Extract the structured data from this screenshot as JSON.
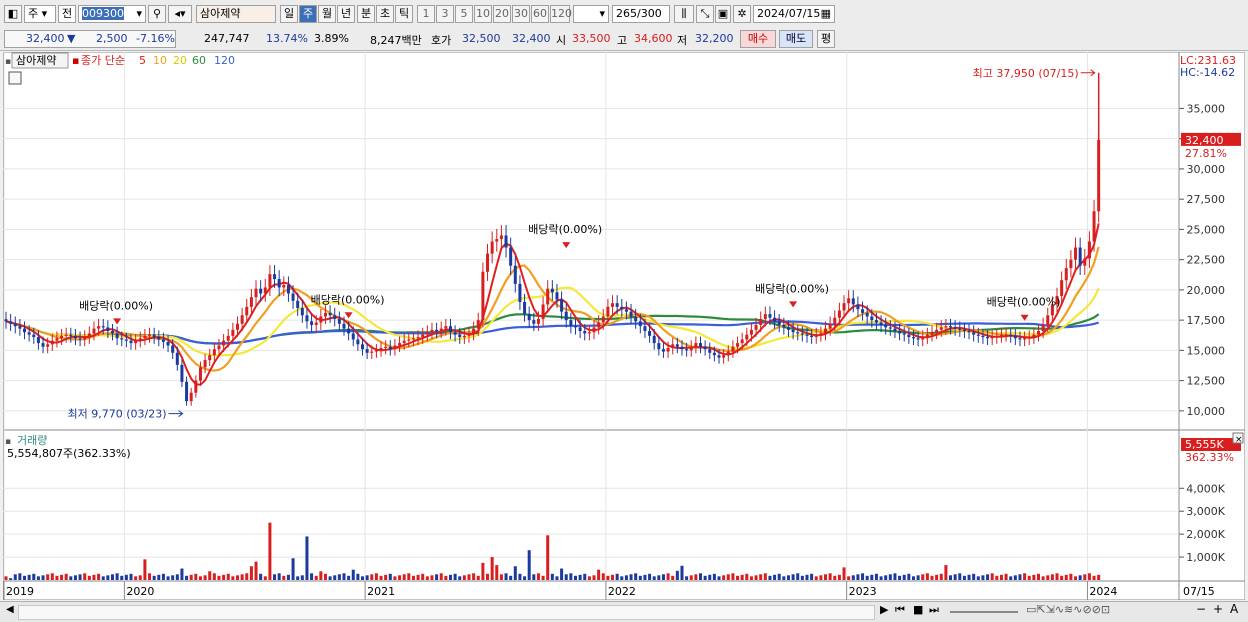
{
  "toolbar": {
    "market": "주",
    "type": "전",
    "code": "009300",
    "name": "삼아제약",
    "periods": [
      "일",
      "주",
      "월",
      "년",
      "분",
      "초",
      "틱"
    ],
    "selected_period": "주",
    "mins": [
      "1",
      "3",
      "5",
      "10",
      "20",
      "30",
      "60",
      "120"
    ],
    "count": "265",
    "count_total": "/300",
    "date": "2024/07/15"
  },
  "info": {
    "price": "32,400",
    "arrow": "▼",
    "change": "2,500",
    "change_pct": "-7.16%",
    "volume": "247,747",
    "vol_ratio": "13.74%",
    "turnover": "3.89%",
    "amount": "8,247백만",
    "ask_label": "호가",
    "ask": "32,500",
    "bid": "32,400",
    "open_label": "시",
    "open": "33,500",
    "high_label": "고",
    "high": "34,600",
    "low_label": "저",
    "low": "32,200",
    "buy": "매수",
    "sell": "매도",
    "avg": "평"
  },
  "chart_data": [
    {
      "type": "candlestick",
      "title": "삼아제약",
      "legend": [
        "종가 단순",
        "5",
        "10",
        "20",
        "60",
        "120"
      ],
      "colors": {
        "up": "#d81e1e",
        "down": "#1b3a9e",
        "ma5": "#e02020",
        "ma10": "#f0a020",
        "ma20": "#f5e83a",
        "ma60": "#2e8b3e",
        "ma120": "#3a5fd8"
      },
      "ylim": [
        8500,
        39500
      ],
      "yticks": [
        "10,000",
        "12,500",
        "15,000",
        "17,500",
        "20,000",
        "22,500",
        "25,000",
        "27,500",
        "30,000",
        "32,500",
        "35,000"
      ],
      "xticks": [
        "2019",
        "2020",
        "2021",
        "2022",
        "2023",
        "2024"
      ],
      "x_end_label": "07/15",
      "last_price_label": "32,400",
      "last_pct_label": "27.81%",
      "lc_label": "LC:231.63",
      "hc_label": "HC:-14.62",
      "high_annotation": "최고 37,950 (07/15)",
      "low_annotation": "최저 9,770 (03/23)",
      "dividend_label": "배당락(0.00%)",
      "weekly_close": [
        17400,
        17200,
        17000,
        16800,
        16500,
        16300,
        16100,
        15600,
        15300,
        15500,
        15800,
        16000,
        16200,
        16300,
        16200,
        16000,
        15900,
        16100,
        16400,
        16800,
        17000,
        16900,
        16600,
        16400,
        16000,
        15900,
        15800,
        15600,
        15800,
        16000,
        16200,
        16300,
        16100,
        15900,
        15700,
        15400,
        14800,
        13800,
        12400,
        10800,
        11500,
        12500,
        13600,
        14200,
        14600,
        15100,
        15400,
        15800,
        16200,
        16700,
        17200,
        17900,
        18600,
        19400,
        20100,
        19700,
        20200,
        21300,
        20900,
        20200,
        20400,
        19700,
        19100,
        18500,
        17900,
        17400,
        17100,
        17300,
        17800,
        18100,
        17900,
        17600,
        17200,
        16800,
        16400,
        15900,
        15500,
        15100,
        14800,
        14900,
        15000,
        15200,
        15300,
        15100,
        15400,
        15600,
        15800,
        15900,
        16000,
        16100,
        16300,
        16500,
        16700,
        16600,
        16800,
        17000,
        16500,
        16300,
        16100,
        16200,
        16400,
        16800,
        17500,
        21500,
        23000,
        24000,
        24200,
        24500,
        23500,
        22000,
        20500,
        19000,
        18000,
        17500,
        17200,
        17600,
        18800,
        20100,
        19800,
        19200,
        18200,
        17500,
        17000,
        16900,
        16600,
        16400,
        16500,
        16900,
        17300,
        17800,
        18600,
        18900,
        18600,
        18400,
        18200,
        17800,
        17400,
        17000,
        16600,
        16200,
        15600,
        15100,
        14900,
        15200,
        15500,
        15300,
        15100,
        15000,
        15300,
        15600,
        15300,
        15100,
        14800,
        14600,
        14400,
        14600,
        14900,
        15300,
        15600,
        15900,
        16300,
        16700,
        17100,
        17600,
        18000,
        17700,
        17400,
        17100,
        16900,
        16700,
        16500,
        16400,
        16300,
        16200,
        16100,
        16300,
        16400,
        16800,
        17200,
        17700,
        18300,
        18900,
        19300,
        18800,
        18400,
        18100,
        17800,
        17500,
        17300,
        17100,
        16900,
        16800,
        16600,
        16400,
        16300,
        16100,
        16000,
        15900,
        16100,
        16300,
        16500,
        16700,
        16900,
        17000,
        16900,
        16800,
        16700,
        16600,
        16500,
        16300,
        16200,
        16100,
        16000,
        16100,
        16200,
        16300,
        16300,
        16200,
        16000,
        15900,
        16000,
        16100,
        16300,
        16600,
        17100,
        17900,
        18800,
        19500,
        20800,
        21800,
        22500,
        23500,
        22000,
        22600,
        24000,
        26500,
        32400
      ]
    },
    {
      "type": "bar",
      "title": "거래량",
      "last_value_text": "5,554,807주(362.33%)",
      "yticks": [
        "1,000K",
        "2,000K",
        "3,000K",
        "4,000K"
      ],
      "ylim": [
        0,
        5800
      ],
      "last_value_label": "5,555K",
      "last_pct_label": "362.33%",
      "spikes": [
        {
          "week": 1,
          "value": 80
        },
        {
          "week": 30,
          "value": 900
        },
        {
          "week": 38,
          "value": 500
        },
        {
          "week": 44,
          "value": 380
        },
        {
          "week": 53,
          "value": 600
        },
        {
          "week": 54,
          "value": 800
        },
        {
          "week": 57,
          "value": 2500
        },
        {
          "week": 62,
          "value": 950
        },
        {
          "week": 65,
          "value": 1900
        },
        {
          "week": 68,
          "value": 380
        },
        {
          "week": 75,
          "value": 450
        },
        {
          "week": 103,
          "value": 750
        },
        {
          "week": 105,
          "value": 1000
        },
        {
          "week": 106,
          "value": 650
        },
        {
          "week": 110,
          "value": 600
        },
        {
          "week": 113,
          "value": 1300
        },
        {
          "week": 117,
          "value": 1950
        },
        {
          "week": 120,
          "value": 500
        },
        {
          "week": 128,
          "value": 450
        },
        {
          "week": 145,
          "value": 400
        },
        {
          "week": 146,
          "value": 620
        },
        {
          "week": 181,
          "value": 550
        },
        {
          "week": 203,
          "value": 650
        },
        {
          "week": 240,
          "value": 1750
        },
        {
          "week": 243,
          "value": 1150
        },
        {
          "week": 244,
          "value": 350
        },
        {
          "week": 245,
          "value": 600
        },
        {
          "week": 247,
          "value": 700
        },
        {
          "week": 248,
          "value": 450
        },
        {
          "week": 250,
          "value": 1550
        },
        {
          "week": 251,
          "value": 5555
        }
      ]
    }
  ]
}
